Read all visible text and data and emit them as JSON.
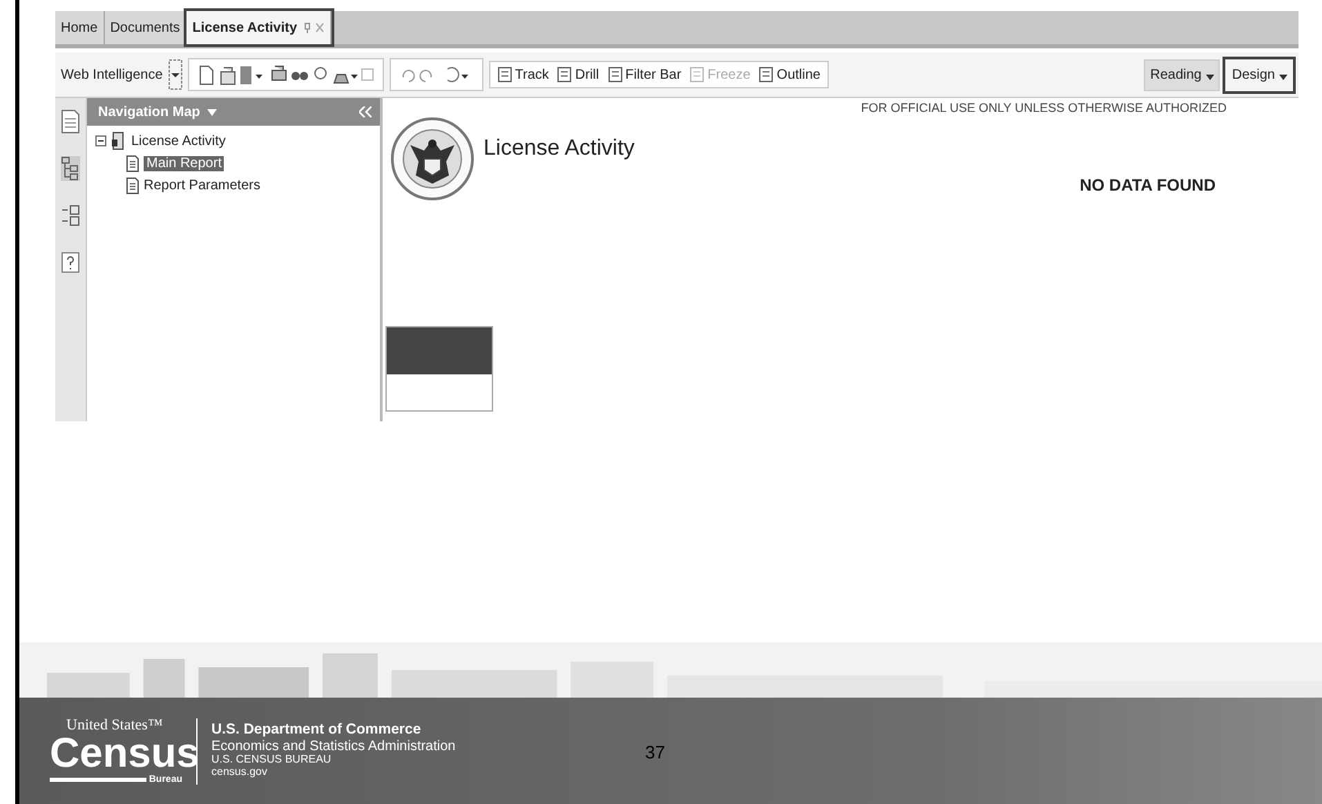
{
  "tabs": [
    {
      "label": "Home",
      "selected": false,
      "highlighted": false
    },
    {
      "label": "Documents",
      "selected": false,
      "highlighted": false
    },
    {
      "label": "License Activity",
      "selected": true,
      "highlighted": true
    }
  ],
  "toolbar": {
    "app_menu": "Web Intelligence",
    "items": [
      {
        "label": "Track",
        "disabled": false
      },
      {
        "label": "Drill",
        "disabled": false
      },
      {
        "label": "Filter Bar",
        "disabled": false
      },
      {
        "label": "Freeze",
        "disabled": true
      },
      {
        "label": "Outline",
        "disabled": false
      }
    ],
    "modes": [
      {
        "label": "Reading",
        "selected": true,
        "highlighted": false
      },
      {
        "label": "Design",
        "selected": false,
        "highlighted": true
      }
    ]
  },
  "navigation": {
    "title": "Navigation Map",
    "tree": [
      {
        "label": "License Activity",
        "expanded": true,
        "children": [
          {
            "label": "Main Report",
            "selected": true
          },
          {
            "label": "Report Parameters",
            "selected": false
          }
        ]
      }
    ]
  },
  "report": {
    "title": "License Activity",
    "notice": "FOR OFFICIAL USE ONLY UNLESS OTHERWISE AUTHORIZED",
    "message": "NO DATA FOUND"
  },
  "footer": {
    "logo_top": "United States™",
    "logo_main": "Census",
    "logo_sub": "Bureau",
    "department": "U.S. Department of Commerce",
    "lines": [
      "Economics and Statistics Administration",
      "U.S. CENSUS BUREAU",
      "census.gov"
    ],
    "page": "37"
  }
}
